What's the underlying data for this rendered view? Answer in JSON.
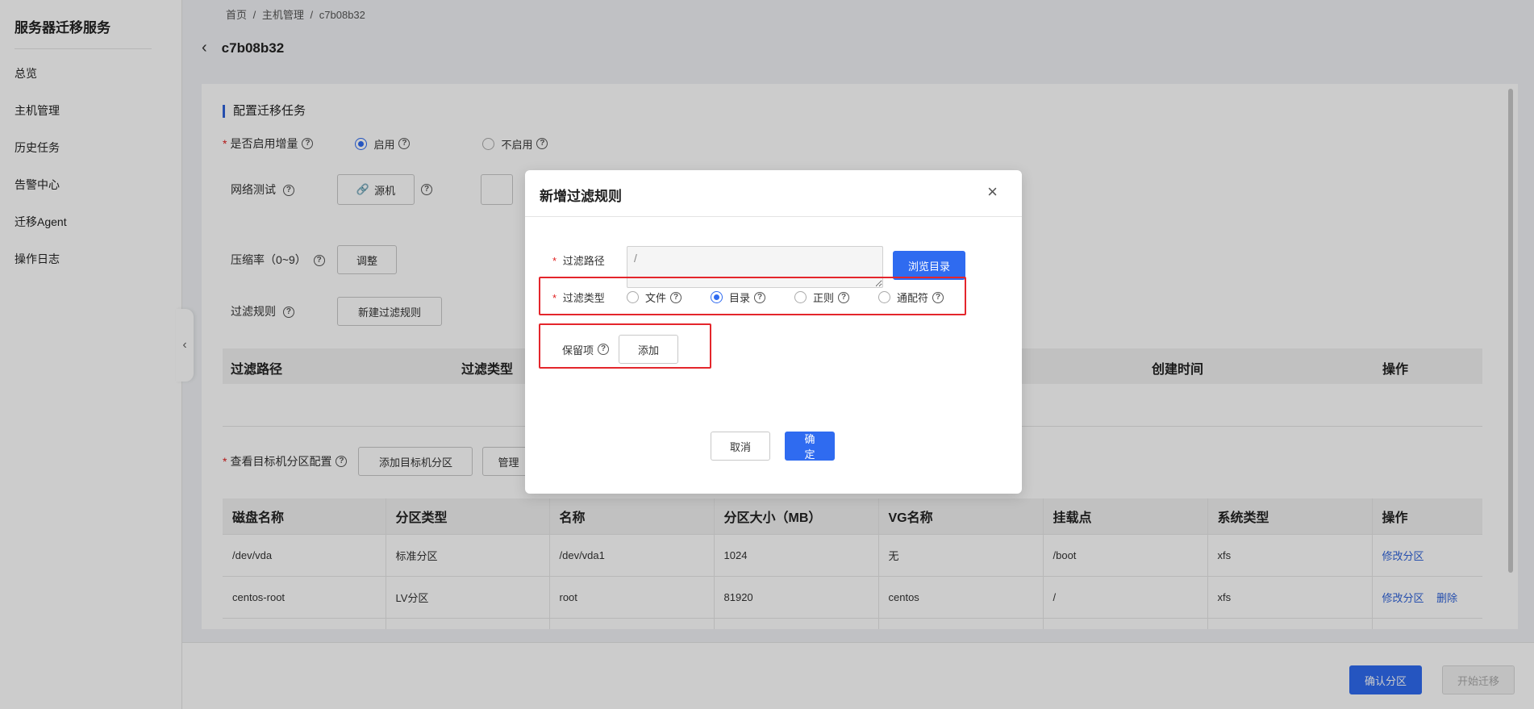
{
  "sidebar": {
    "app_title": "服务器迁移服务",
    "items": [
      {
        "label": "总览"
      },
      {
        "label": "主机管理"
      },
      {
        "label": "历史任务"
      },
      {
        "label": "告警中心"
      },
      {
        "label": "迁移Agent"
      },
      {
        "label": "操作日志"
      }
    ],
    "collapse_icon": "‹"
  },
  "breadcrumb": {
    "home": "首页",
    "sep1": "/",
    "hosts": "主机管理",
    "sep2": "/",
    "current": "c7b08b32"
  },
  "header": {
    "title": "c7b08b32",
    "back_icon": "‹"
  },
  "config": {
    "section_title": "配置迁移任务",
    "incremental": {
      "label": "是否启用增量",
      "required_mark": "*",
      "option_on": "启用",
      "option_off": "不启用",
      "selected": "启用"
    },
    "network_test": {
      "label": "网络测试",
      "source_button": "源机"
    },
    "compression": {
      "label": "压缩率（0~9）",
      "button": "调整"
    },
    "filter_rules": {
      "label": "过滤规则",
      "button": "新建过滤规则",
      "columns": [
        "过滤路径",
        "过滤类型",
        "创建时间",
        "操作"
      ]
    },
    "partitions": {
      "label": "查看目标机分区配置",
      "required_mark": "*",
      "add_button": "添加目标机分区",
      "manage_button": "管理",
      "columns": [
        "磁盘名称",
        "分区类型",
        "名称",
        "分区大小（MB）",
        "VG名称",
        "挂载点",
        "系统类型",
        "操作"
      ],
      "rows": [
        {
          "disk": "/dev/vda",
          "type": "标准分区",
          "name": "/dev/vda1",
          "size": "1024",
          "vg": "无",
          "mount": "/boot",
          "fs": "xfs",
          "action1": "修改分区",
          "action2": ""
        },
        {
          "disk": "centos-root",
          "type": "LV分区",
          "name": "root",
          "size": "81920",
          "vg": "centos",
          "mount": "/",
          "fs": "xfs",
          "action1": "修改分区",
          "action2": "删除"
        }
      ]
    }
  },
  "footer": {
    "confirm_button": "确认分区",
    "start_button": "开始迁移"
  },
  "modal": {
    "title": "新增过滤规则",
    "close_icon": "×",
    "path": {
      "label": "过滤路径",
      "required_mark": "*",
      "value": "/",
      "browse_button": "浏览目录"
    },
    "filter_type": {
      "label": "过滤类型",
      "required_mark": "*",
      "options": [
        "文件",
        "目录",
        "正则",
        "通配符"
      ],
      "selected": "目录"
    },
    "retain": {
      "label": "保留项",
      "add_button": "添加"
    },
    "cancel_button": "取消",
    "ok_button": "确定"
  },
  "colors": {
    "primary": "#2f6bf0",
    "highlight": "#e4262c",
    "required": "#e02020"
  }
}
